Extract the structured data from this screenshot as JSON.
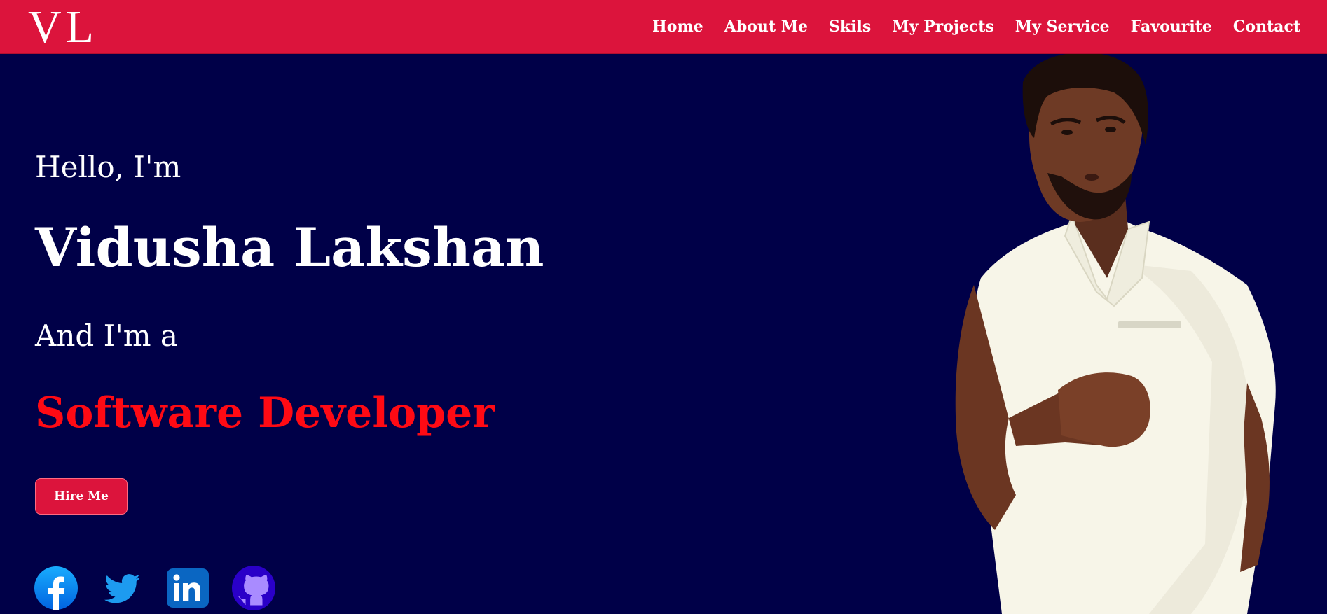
{
  "brand": {
    "logo_text": "VL"
  },
  "nav": {
    "items": [
      {
        "label": "Home"
      },
      {
        "label": "About Me"
      },
      {
        "label": "Skils"
      },
      {
        "label": "My Projects"
      },
      {
        "label": "My Service"
      },
      {
        "label": "Favourite"
      },
      {
        "label": "Contact"
      }
    ]
  },
  "hero": {
    "greeting": "Hello, I'm",
    "name": "Vidusha Lakshan",
    "intro": "And I'm a",
    "role": "Software Developer",
    "cta_label": "Hire Me"
  },
  "socials": [
    {
      "icon": "facebook-icon"
    },
    {
      "icon": "twitter-icon"
    },
    {
      "icon": "linkedin-icon"
    },
    {
      "icon": "github-icon"
    }
  ],
  "colors": {
    "navbar": "#dc143c",
    "background": "#000048",
    "accent_text": "#ff0a14",
    "text": "#ffffff"
  }
}
